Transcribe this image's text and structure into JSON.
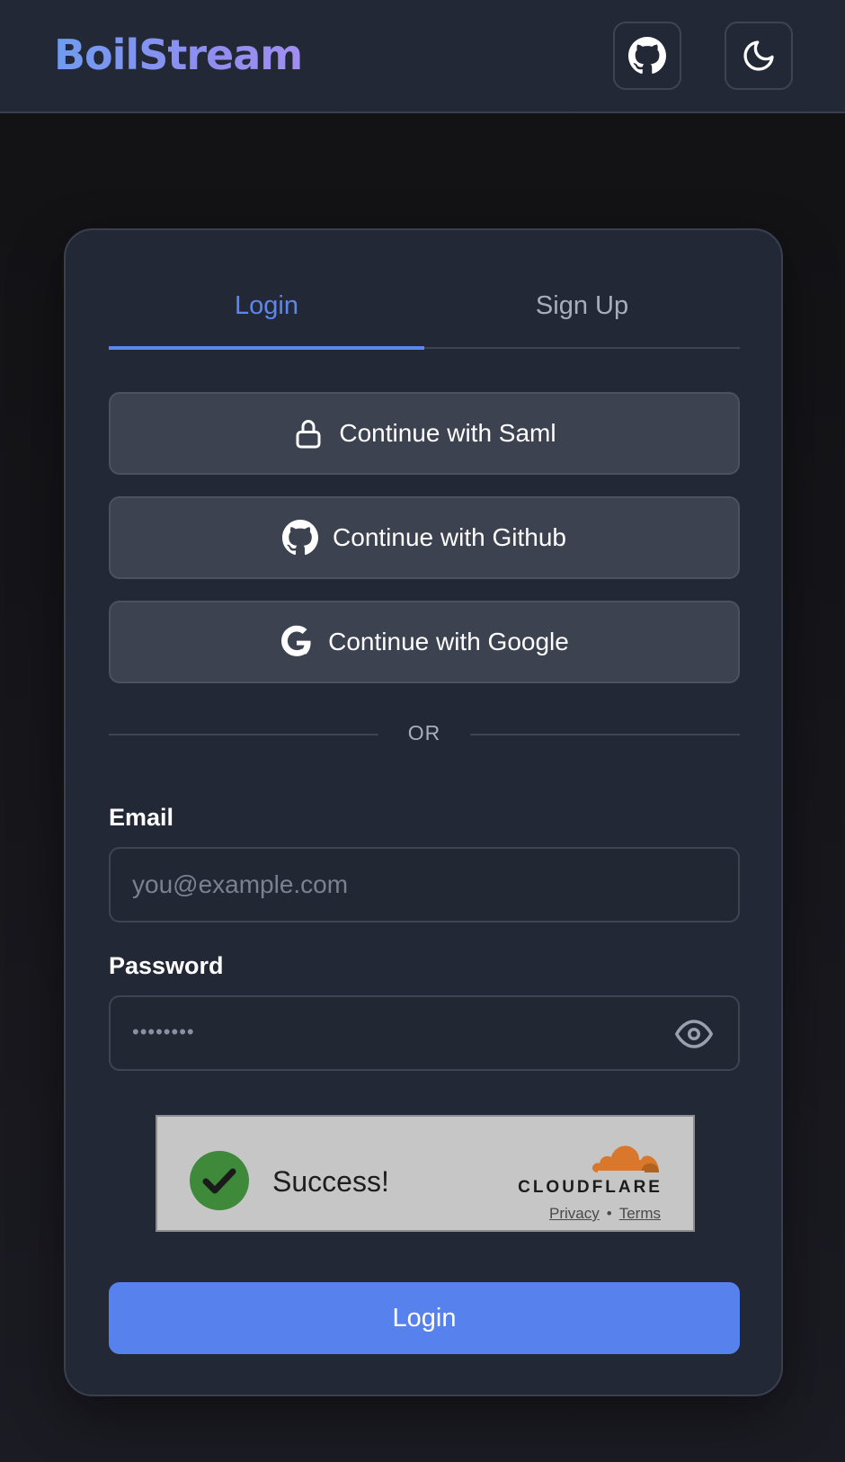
{
  "header": {
    "brand": "BoilStream",
    "github_icon": "github-icon",
    "theme_icon": "moon-icon"
  },
  "tabs": [
    {
      "label": "Login",
      "active": true
    },
    {
      "label": "Sign Up",
      "active": false
    }
  ],
  "sso": [
    {
      "label": "Continue with Saml",
      "icon": "lock-icon"
    },
    {
      "label": "Continue with Github",
      "icon": "github-icon"
    },
    {
      "label": "Continue with Google",
      "icon": "google-icon"
    }
  ],
  "divider": "OR",
  "email": {
    "label": "Email",
    "placeholder": "you@example.com",
    "value": ""
  },
  "password": {
    "label": "Password",
    "masked_value": "••••••••",
    "toggle_icon": "eye-icon"
  },
  "captcha": {
    "status": "Success!",
    "provider": "CLOUDFLARE",
    "privacy": "Privacy",
    "separator": "•",
    "terms": "Terms"
  },
  "submit_label": "Login",
  "colors": {
    "accent": "#5782ee",
    "success": "#3e8a3a",
    "cloudflare_orange": "#e07a2f"
  }
}
